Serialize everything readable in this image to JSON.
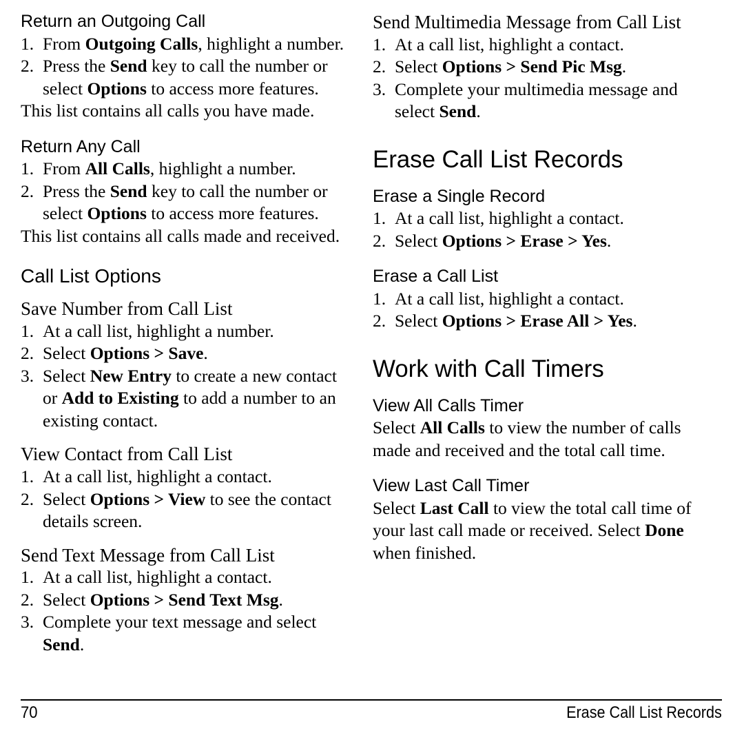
{
  "document": {
    "page_number": "70",
    "running_title": "Erase Call List Records"
  },
  "left_column": {
    "sections": [
      {
        "heading": "Return an Outgoing Call",
        "steps": [
          {
            "num": "1.",
            "text_html": "From <b>Outgoing Calls</b>, highlight a number."
          },
          {
            "num": "2.",
            "text_html": "Press the <b>Send</b> key to call the number or select <b>Options</b> to access more features."
          }
        ],
        "note": "This list contains all calls you have made."
      },
      {
        "heading": "Return Any Call",
        "steps": [
          {
            "num": "1.",
            "text_html": "From <b>All Calls</b>, highlight a number."
          },
          {
            "num": "2.",
            "text_html": "Press the <b>Send</b> key to call the number or select <b>Options</b> to access more features."
          }
        ],
        "note": "This list contains all calls made and received."
      },
      {
        "heading": "Call List Options"
      },
      {
        "heading": "Save Number from Call List",
        "steps": [
          {
            "num": "1.",
            "text_html": "At a call list, highlight a number."
          },
          {
            "num": "2.",
            "text_html": "Select <b>Options &gt; Save</b>."
          },
          {
            "num": "3.",
            "text_html": "Select <b>New Entry</b> to create a new contact or <b>Add to Existing</b> to add a number to an existing contact."
          }
        ]
      },
      {
        "heading": "View Contact from Call List",
        "steps": [
          {
            "num": "1.",
            "text_html": "At a call list, highlight a contact."
          },
          {
            "num": "2.",
            "text_html": "Select <b>Options &gt; View</b> to see the contact details screen."
          }
        ]
      },
      {
        "heading": "Send Text Message from Call List",
        "steps": [
          {
            "num": "1.",
            "text_html": "At a call list, highlight a contact."
          },
          {
            "num": "2.",
            "text_html": "Select <b>Options &gt; Send Text Msg</b>."
          },
          {
            "num": "3.",
            "text_html": "Complete your text message and select <b>Send</b>."
          }
        ]
      }
    ]
  },
  "right_column": {
    "sections": [
      {
        "heading": "Send Multimedia Message from Call List",
        "steps": [
          {
            "num": "1.",
            "text_html": "At a call list, highlight a contact."
          },
          {
            "num": "2.",
            "text_html": "Select <b>Options &gt; Send Pic Msg</b>."
          },
          {
            "num": "3.",
            "text_html": "Complete your multimedia message and select <b>Send</b>."
          }
        ]
      },
      {
        "heading": "Erase Call List Records"
      },
      {
        "heading": "Erase a Single Record",
        "steps": [
          {
            "num": "1.",
            "text_html": "At a call list, highlight a contact."
          },
          {
            "num": "2.",
            "text_html": "Select <b>Options &gt; Erase &gt; Yes</b>."
          }
        ]
      },
      {
        "heading": "Erase a Call List",
        "steps": [
          {
            "num": "1.",
            "text_html": "At a call list, highlight a contact."
          },
          {
            "num": "2.",
            "text_html": "Select <b>Options &gt; Erase All &gt; Yes</b>."
          }
        ]
      },
      {
        "heading": "Work with Call Timers"
      },
      {
        "heading": "View All Calls Timer",
        "body_html": "Select <b>All Calls</b> to view the number of calls made and received and the total call time."
      },
      {
        "heading": "View Last Call Timer",
        "body_html": "Select <b>Last Call</b> to view the total call time of your last call made or received. Select <b>Done</b> when finished."
      }
    ]
  }
}
